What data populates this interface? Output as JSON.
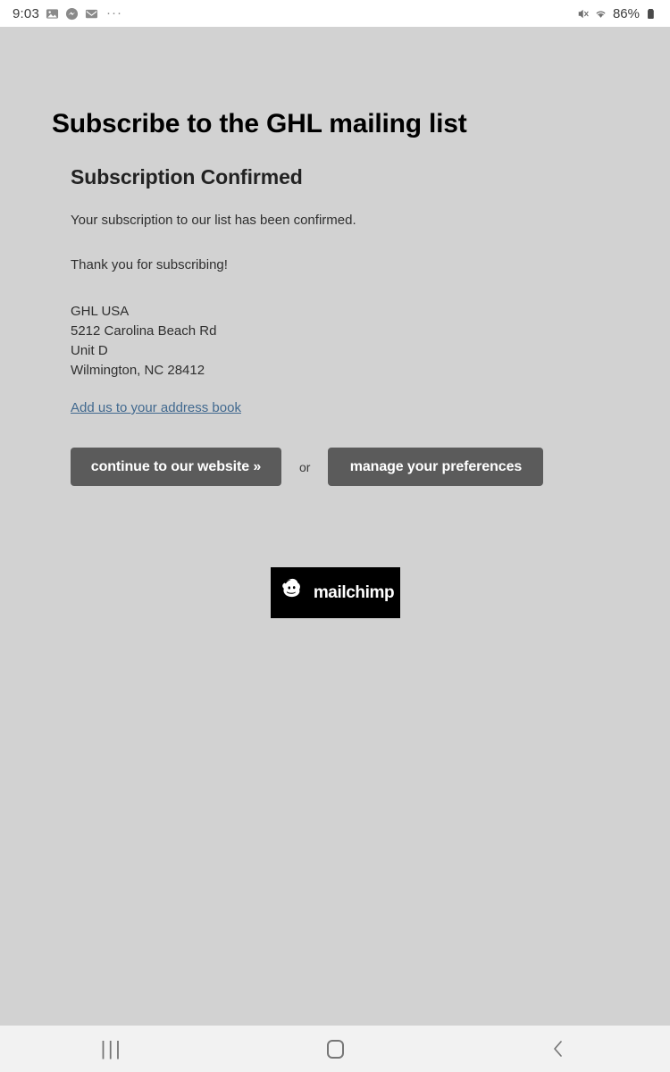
{
  "statusbar": {
    "time": "9:03",
    "icons": [
      "photos-icon",
      "messenger-icon",
      "gmail-icon"
    ],
    "overflow": "···",
    "mute_icon": "mute-icon",
    "wifi_icon": "wifi-icon",
    "battery_percent": "86%",
    "battery_icon": "battery-icon"
  },
  "page": {
    "title": "Subscribe to the GHL mailing list",
    "heading": "Subscription Confirmed",
    "paragraph_1": "Your subscription to our list has been confirmed.",
    "paragraph_2": "Thank you for subscribing!",
    "address": {
      "line1": "GHL USA",
      "line2": "5212 Carolina Beach Rd",
      "line3": "Unit D",
      "line4": "Wilmington, NC 28412"
    },
    "address_book_link": "Add us to your address book",
    "buttons": {
      "continue": "continue to our website »",
      "separator": "or",
      "manage": "manage your preferences"
    },
    "mailchimp": {
      "wordmark": "mailchimp",
      "logo_icon": "mailchimp-freddie-icon"
    }
  },
  "navbar": {
    "recents": "|||",
    "recents_icon": "recents-icon",
    "home_icon": "home-icon",
    "back_icon": "back-chevron-icon"
  },
  "colors": {
    "page_background": "#d2d2d2",
    "button_gray": "#5b5b5b",
    "link_blue": "#41698f",
    "logo_black": "#000000",
    "navbar_background": "#f2f2f2"
  }
}
